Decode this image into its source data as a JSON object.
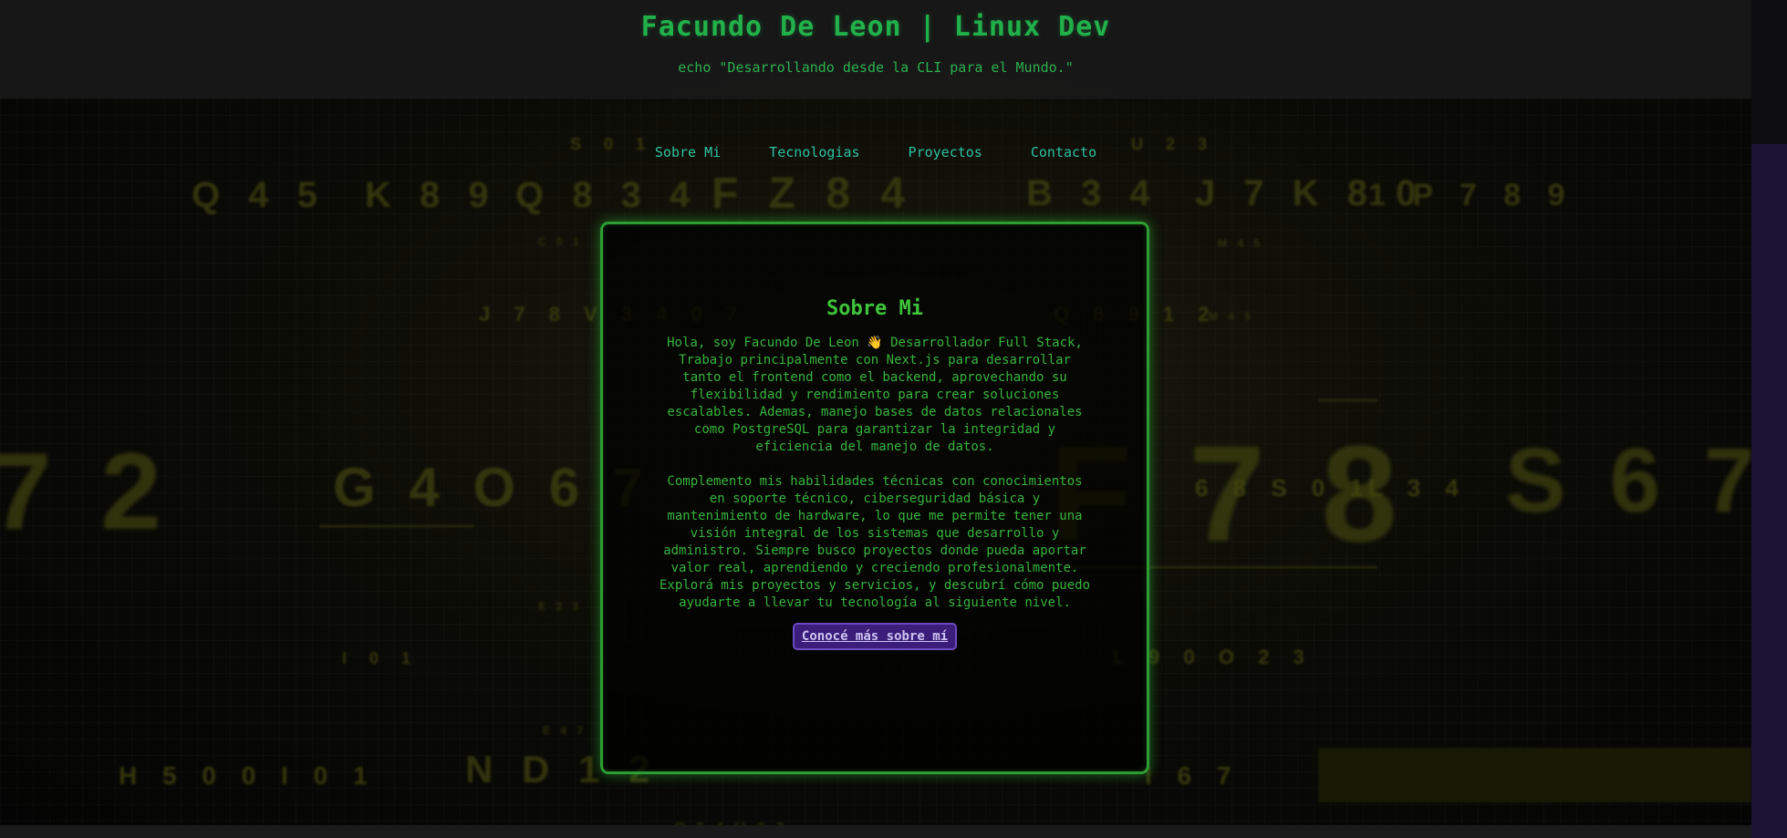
{
  "header": {
    "title": "Facundo De Leon | Linux Dev",
    "tagline": "echo \"Desarrollando desde la CLI para el Mundo.\""
  },
  "nav": {
    "items": [
      {
        "label": "Sobre Mi"
      },
      {
        "label": "Tecnologias"
      },
      {
        "label": "Proyectos"
      },
      {
        "label": "Contacto"
      }
    ]
  },
  "about": {
    "title": "Sobre Mi",
    "paragraph1": "Hola, soy Facundo De Leon 👋 Desarrollador Full Stack, Trabajo principalmente con Next.js para desarrollar tanto el frontend como el backend, aprovechando su flexibilidad y rendimiento para crear soluciones escalables. Ademas, manejo bases de datos relacionales como PostgreSQL para garantizar la integridad y eficiencia del manejo de datos.",
    "paragraph2": "Complemento mis habilidades técnicas con conocimientos en soporte técnico, ciberseguridad básica y mantenimiento de hardware, lo que me permite tener una visión integral de los sistemas que desarrollo y administro. Siempre busco proyectos donde pueda aportar valor real, aprendiendo y creciendo profesionalmente. Explorá mis proyectos y servicios, y descubrí cómo puedo ayudarte a llevar tu tecnología al siguiente nivel.",
    "button_label": "Conocé más sobre mí"
  },
  "colors": {
    "accent_green": "#2c9c33",
    "title_green": "#22b04a",
    "nav_teal": "#2cc0a0",
    "button_purple": "#3b1d7a"
  }
}
